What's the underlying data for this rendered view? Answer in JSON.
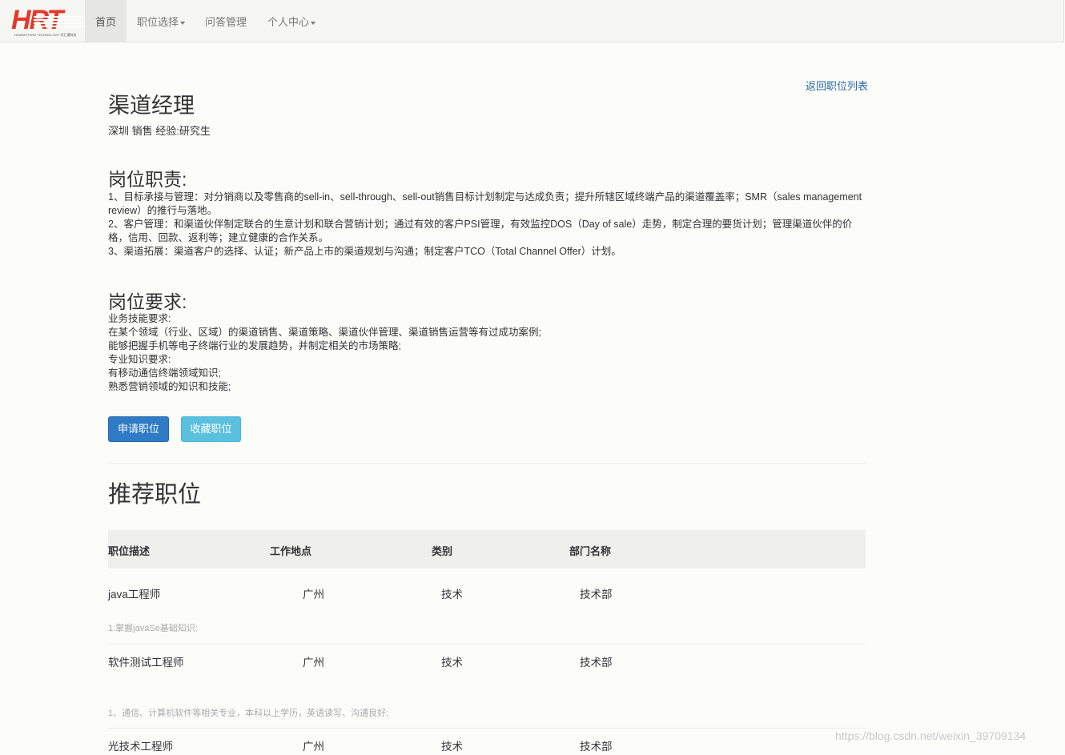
{
  "nav": {
    "logo_text": "HRT",
    "logo_tagline": "HUAWEITONG TECHNOLOGY 华汇通科技",
    "items": [
      {
        "label": "首页"
      },
      {
        "label": "职位选择"
      },
      {
        "label": "问答管理"
      },
      {
        "label": "个人中心"
      }
    ]
  },
  "job": {
    "back_link": "返回职位列表",
    "title": "渠道经理",
    "meta": "深圳 销售 经验:研究生",
    "duties_heading": "岗位职责:",
    "duties": [
      "1、目标承接与管理：对分销商以及零售商的sell-in、sell-through、sell-out销售目标计划制定与达成负责；提升所辖区域终端产品的渠道覆盖率；SMR（sales management review）的推行与落地。",
      "2、客户管理：和渠道伙伴制定联合的生意计划和联合营销计划；通过有效的客户PSI管理，有效监控DOS（Day of sale）走势，制定合理的要货计划；管理渠道伙伴的价格，信用、回款、返利等；建立健康的合作关系。",
      "3、渠道拓展：渠道客户的选择、认证；新产品上市的渠道规划与沟通；制定客户TCO（Total Channel Offer）计划。"
    ],
    "req_heading": "岗位要求:",
    "requirements": [
      "业务技能要求:",
      "在某个领域（行业、区域）的渠道销售、渠道策略、渠道伙伴管理、渠道销售运营等有过成功案例;",
      "能够把握手机等电子终端行业的发展趋势，并制定相关的市场策略;",
      "专业知识要求:",
      "有移动通信终端领域知识;",
      "熟悉营销领域的知识和技能;"
    ],
    "apply_button": "申请职位",
    "favorite_button": "收藏职位"
  },
  "recommend": {
    "heading": "推荐职位",
    "columns": [
      "职位描述",
      "工作地点",
      "类别",
      "部门名称"
    ],
    "rows": [
      {
        "name": "java工程师",
        "location": "广州",
        "category": "技术",
        "dept": "技术部",
        "desc": "1.掌握javaSe基础知识;"
      },
      {
        "name": "软件测试工程师",
        "location": "广州",
        "category": "技术",
        "dept": "技术部",
        "desc": "1、通信、计算机软件等相关专业，本科以上学历，英语读写、沟通良好;"
      },
      {
        "name": "光技术工程师",
        "location": "广州",
        "category": "技术",
        "dept": "技术部",
        "desc": ""
      }
    ]
  },
  "watermark": "https://blog.csdn.net/weixin_39709134",
  "colors": {
    "primary": "#2f7bc6",
    "info": "#5bc0de",
    "link": "#2a6aa8",
    "logo": "#e23a2a"
  }
}
